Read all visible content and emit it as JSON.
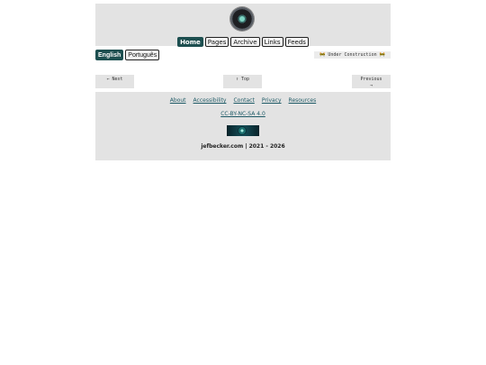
{
  "header": {
    "logo_icon": "orb-logo-icon",
    "nav": [
      {
        "label": "Home",
        "active": true
      },
      {
        "label": "Pages",
        "active": false
      },
      {
        "label": "Archive",
        "active": false
      },
      {
        "label": "Links",
        "active": false
      },
      {
        "label": "Feeds",
        "active": false
      }
    ]
  },
  "language": [
    {
      "label": "English",
      "active": true
    },
    {
      "label": "Português",
      "active": false
    }
  ],
  "notice": {
    "warn_symbol": "🚧",
    "text": "Under Construction"
  },
  "pager": {
    "next": "← Next",
    "top": "↑ Top",
    "previous_line1": "Previous",
    "previous_line2": "→"
  },
  "footer": {
    "links": [
      "About",
      "Accessibility",
      "Contact",
      "Privacy",
      "Resources"
    ],
    "license": "CC-BY-NC-SA 4.0",
    "banner_icon": "site-banner-image",
    "copyright": "jefbecker.com | 2021 - 2026"
  },
  "colors": {
    "accent": "#1d4f50",
    "link": "#1e5a66",
    "panel": "#e3e3e3"
  }
}
